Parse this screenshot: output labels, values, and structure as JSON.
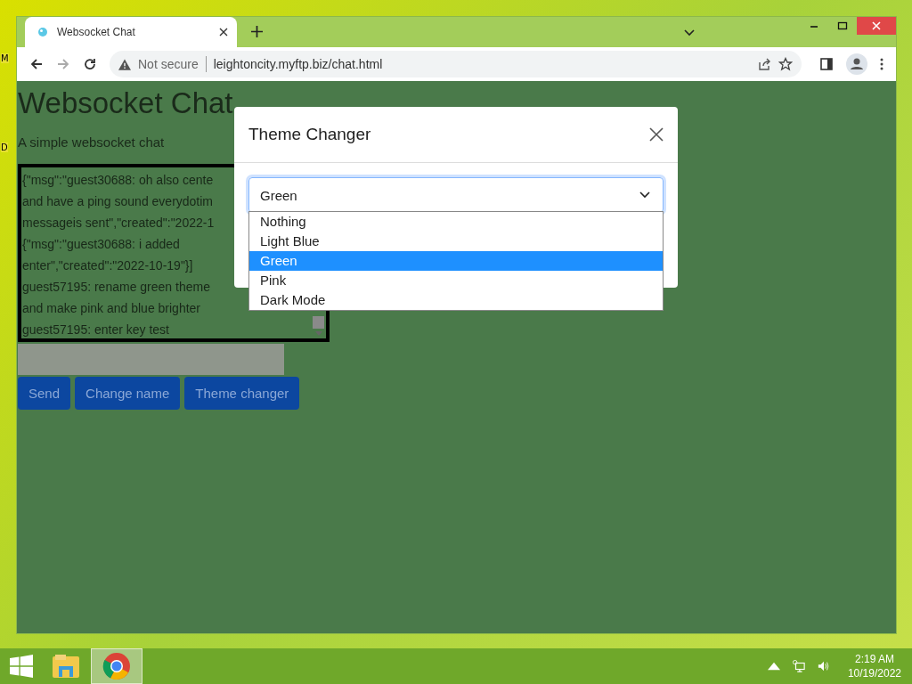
{
  "desktop": {
    "edge_labels": [
      "M",
      "D"
    ]
  },
  "browser": {
    "tab": {
      "title": "Websocket Chat",
      "selected": true
    },
    "security": "Not secure",
    "url": "leightoncity.myftp.biz/chat.html"
  },
  "page": {
    "heading": "Websocket Chat",
    "subtitle": "A simple websocket chat",
    "chat_lines": [
      "{\"msg\":\"guest30688: oh also cente",
      "and have a ping sound everydotim",
      "messageis sent\",\"created\":\"2022-1",
      "{\"msg\":\"guest30688: i added",
      "enter\",\"created\":\"2022-10-19\"}]",
      "guest57195: rename green theme",
      "and make pink and blue brighter",
      "guest57195: enter key test"
    ],
    "buttons": [
      "Send",
      "Change name",
      "Theme changer"
    ]
  },
  "modal": {
    "title": "Theme Changer",
    "select": {
      "value": "Green",
      "expanded": true
    },
    "options": [
      {
        "label": "Nothing",
        "selected": false
      },
      {
        "label": "Light Blue",
        "selected": false
      },
      {
        "label": "Green",
        "selected": true
      },
      {
        "label": "Pink",
        "selected": false
      },
      {
        "label": "Dark Mode",
        "selected": false
      }
    ]
  },
  "taskbar": {
    "time": "2:19 AM",
    "date": "10/19/2022"
  }
}
